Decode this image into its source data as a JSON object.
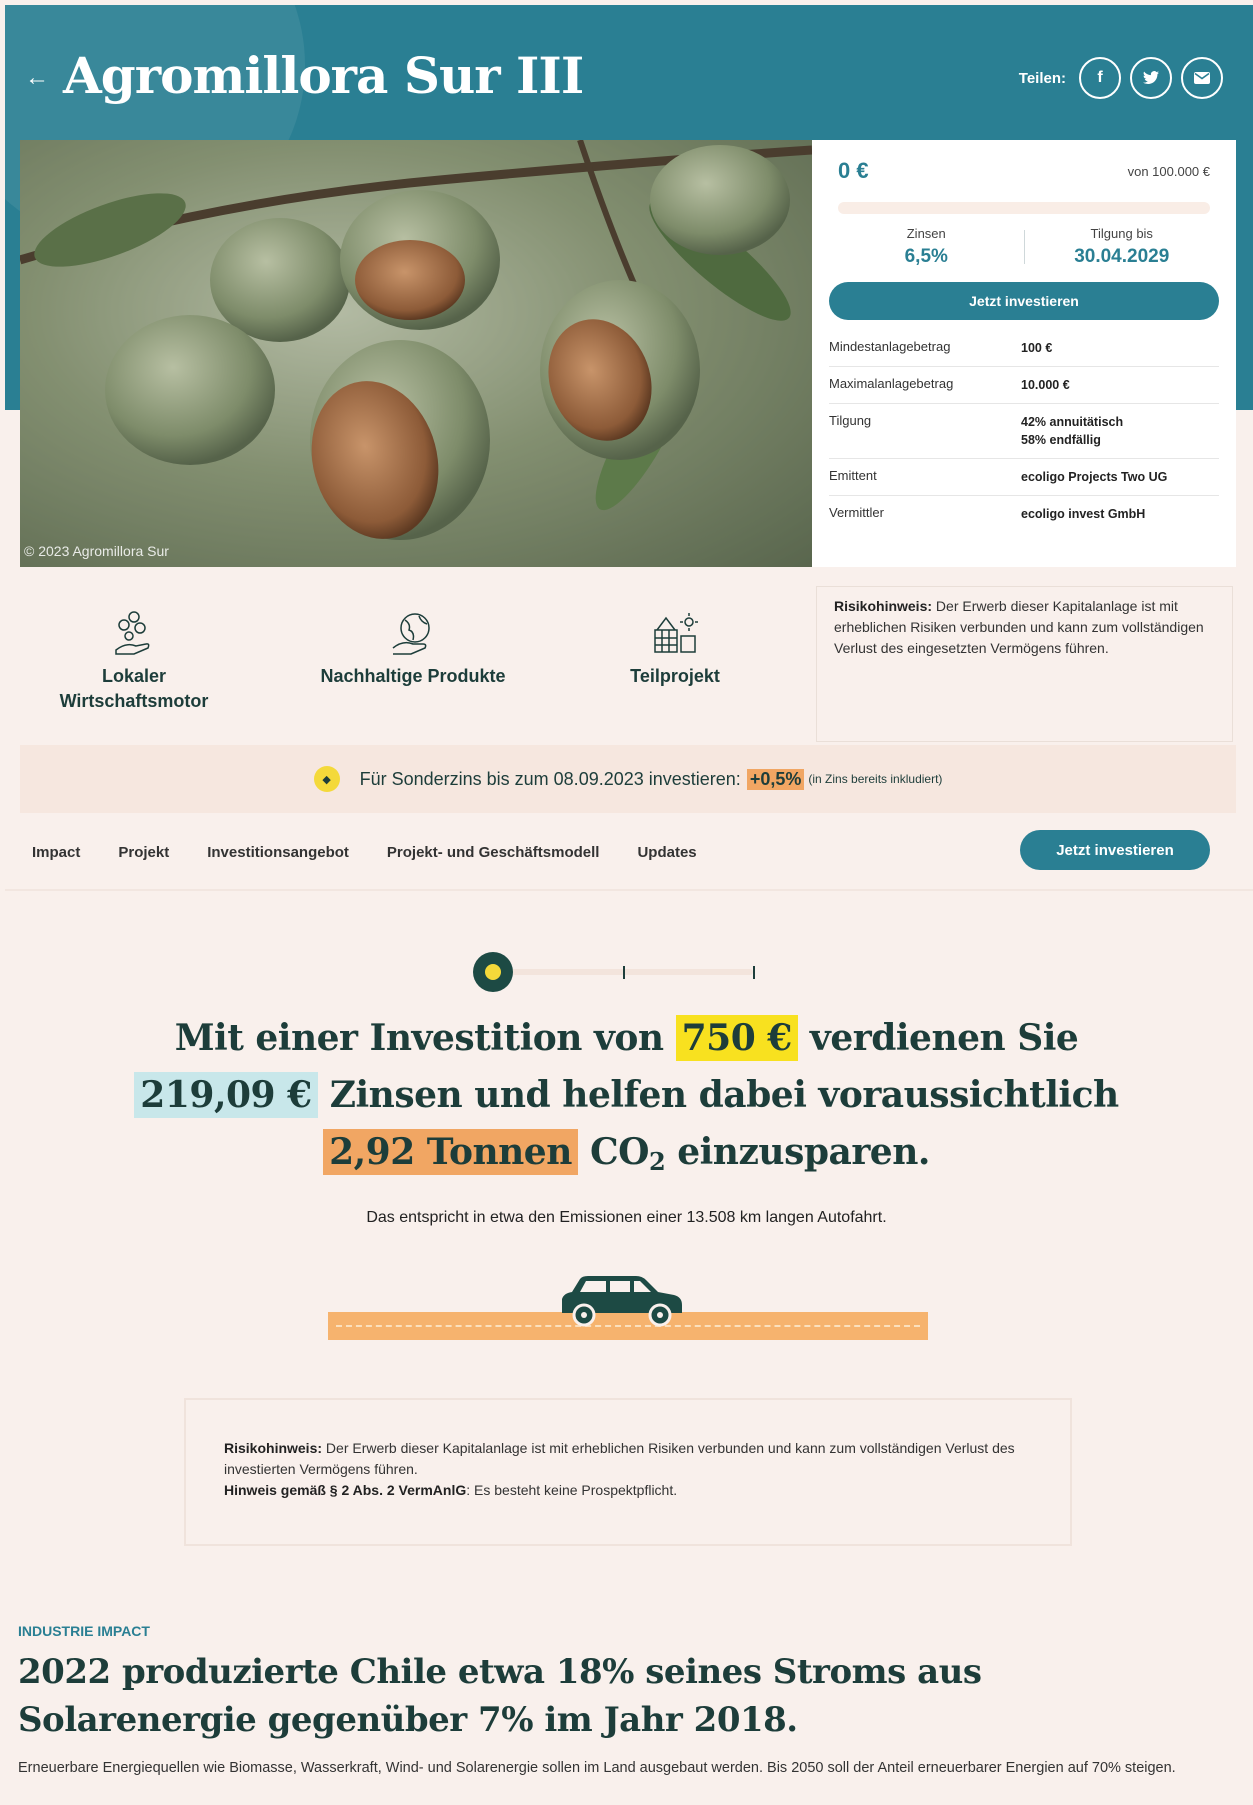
{
  "header": {
    "back_icon": "arrow-left-icon",
    "title": "Agromillora Sur III",
    "share_label": "Teilen:",
    "share_icons": [
      "facebook-icon",
      "twitter-icon",
      "mail-icon"
    ],
    "bg_color": "#2a7f93"
  },
  "hero": {
    "copyright": "© 2023 Agromillora Sur"
  },
  "card": {
    "amount": "0 €",
    "of_total": "von 100.000 €",
    "progress_fraction": 0,
    "interest_label": "Zinsen",
    "interest_value": "6,5%",
    "repay_label": "Tilgung bis",
    "repay_value": "30.04.2029",
    "cta": "Jetzt investieren",
    "rows": [
      {
        "k": "Mindestanlagebetrag",
        "v": "100 €"
      },
      {
        "k": "Maximalanlagebetrag",
        "v": "10.000 €"
      },
      {
        "k": "Tilgung",
        "v": "42% annuitätisch",
        "v2": "58% endfällig"
      },
      {
        "k": "Emittent",
        "v": "ecoligo Projects Two UG"
      },
      {
        "k": "Vermittler",
        "v": "ecoligo invest GmbH"
      }
    ]
  },
  "features": [
    {
      "label1": "Lokaler",
      "label2": "Wirtschaftsmotor",
      "icon": "coins-hand-icon"
    },
    {
      "label1": "Nachhaltige Produkte",
      "icon": "globe-hand-icon"
    },
    {
      "label1": "Teilprojekt",
      "icon": "solar-panel-icon"
    }
  ],
  "risk_side": {
    "bold": "Risikohinweis:",
    "text": " Der Erwerb dieser Kapitalanlage ist mit erheblichen Risiken verbunden und kann zum vollständigen Verlust des eingesetzten Vermögens führen."
  },
  "banner": {
    "icon": "tag-icon",
    "text": "Für Sonderzins bis zum 08.09.2023 investieren:",
    "highlight": "+0,5%",
    "note": "(in Zins bereits inkludiert)"
  },
  "nav": {
    "items": [
      "Impact",
      "Projekt",
      "Investitionsangebot",
      "Projekt- und Geschäftsmodell",
      "Updates"
    ],
    "cta": "Jetzt investieren"
  },
  "slider": {
    "position_fraction": 0
  },
  "impact": {
    "p1": "Mit einer Investition von",
    "investment": "750 €",
    "p2": "verdienen Sie",
    "interest": "219,09 €",
    "p3": "Zinsen und helfen dabei voraussichtlich",
    "co2": "2,92 Tonnen",
    "p4": "CO",
    "sub": "2",
    "p5": "einzusparen.",
    "equivalent": "Das entspricht in etwa den Emissionen einer 13.508 km langen Autofahrt."
  },
  "risk_box": {
    "bold1": "Risikohinweis:",
    "text1": " Der Erwerb dieser Kapitalanlage ist mit erheblichen Risiken verbunden und kann zum vollständigen Verlust des investierten Vermögens führen.",
    "bold2": "Hinweis gemäß § 2 Abs. 2 VermAnlG",
    "text2": ": Es besteht keine Prospektpflicht."
  },
  "industry": {
    "label": "INDUSTRIE IMPACT",
    "title": "2022 produzierte Chile etwa 18% seines Stroms aus Solarenergie gegenüber 7% im Jahr 2018.",
    "text": "Erneuerbare Energiequellen wie Biomasse, Wasserkraft, Wind- und Solarenergie sollen im Land ausgebaut werden. Bis 2050 soll der Anteil erneuerbarer Energien auf 70% steigen."
  }
}
